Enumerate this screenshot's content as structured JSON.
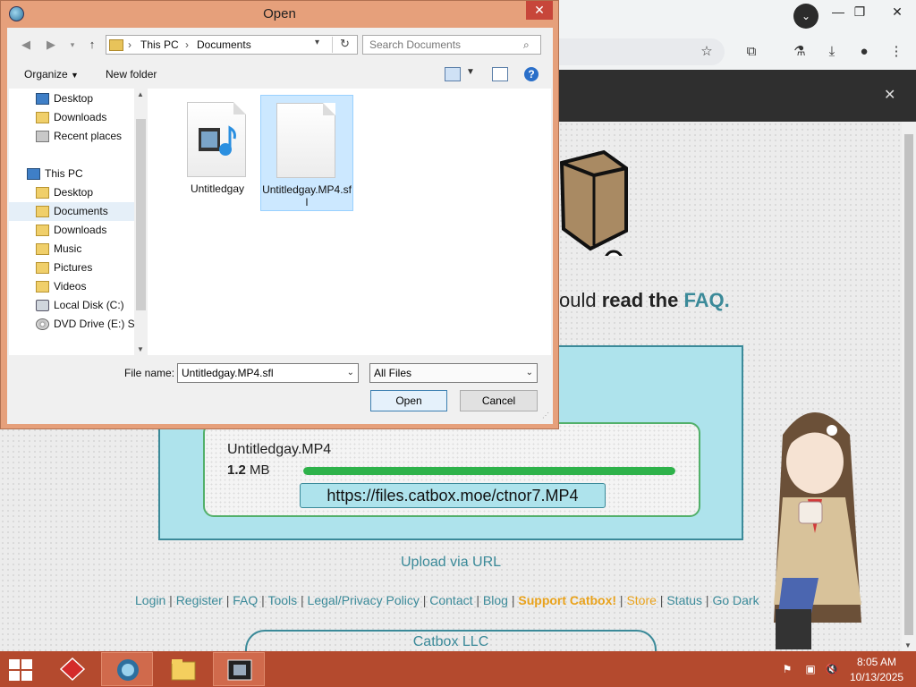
{
  "dialog": {
    "title": "Open",
    "breadcrumb": [
      "This PC",
      "Documents"
    ],
    "search_placeholder": "Search Documents",
    "organize_label": "Organize",
    "new_folder_label": "New folder",
    "nav_items": [
      {
        "label": "Desktop",
        "icon": "desktop-icon"
      },
      {
        "label": "Downloads",
        "icon": "downloads-folder-icon"
      },
      {
        "label": "Recent places",
        "icon": "recent-places-icon"
      },
      {
        "label": "This PC",
        "icon": "computer-icon"
      },
      {
        "label": "Desktop",
        "icon": "folder-icon"
      },
      {
        "label": "Documents",
        "icon": "folder-icon",
        "selected": true
      },
      {
        "label": "Downloads",
        "icon": "folder-icon"
      },
      {
        "label": "Music",
        "icon": "folder-icon"
      },
      {
        "label": "Pictures",
        "icon": "folder-icon"
      },
      {
        "label": "Videos",
        "icon": "folder-icon"
      },
      {
        "label": "Local Disk (C:)",
        "icon": "disk-icon"
      },
      {
        "label": "DVD Drive (E:) So",
        "icon": "dvd-icon"
      }
    ],
    "files": [
      {
        "name": "Untitledgay",
        "icon": "media-file-icon",
        "selected": false
      },
      {
        "name": "Untitledgay.MP4.sfl",
        "icon": "blank-file-icon",
        "selected": true
      }
    ],
    "file_name_label": "File name:",
    "file_name_value": "Untitledgay.MP4.sfl",
    "file_type_value": "All Files",
    "open_label": "Open",
    "cancel_label": "Cancel"
  },
  "page": {
    "faq_prefix": "ould ",
    "faq_bold": "read the",
    "faq_link": "FAQ.",
    "upload": {
      "file_name": "Untitledgay.MP4",
      "size_number": "1.2",
      "size_unit": " MB",
      "progress": 1.0,
      "url": "https://files.catbox.moe/ctnor7.MP4"
    },
    "upload_via_url": "Upload via URL",
    "footer_links": [
      "Login",
      "Register",
      "FAQ",
      "Tools",
      "Legal/Privacy Policy",
      "Contact",
      "Blog",
      "Support Catbox!",
      "Store",
      "Status",
      "Go Dark"
    ],
    "company": "Catbox LLC"
  },
  "taskbar": {
    "time": "8:05 AM",
    "date": "10/13/2025",
    "apps": [
      "start-icon",
      "app-icon",
      "browser-icon",
      "file-explorer-icon",
      "video-app-icon"
    ]
  },
  "colors": {
    "dialog_frame": "#e6a07b",
    "taskbar": "#b44a2e",
    "catbox_accent": "#3b8a99",
    "upload_bg": "#aee3ec",
    "progress": "#2eb24a",
    "support_link": "#e9a21b"
  }
}
